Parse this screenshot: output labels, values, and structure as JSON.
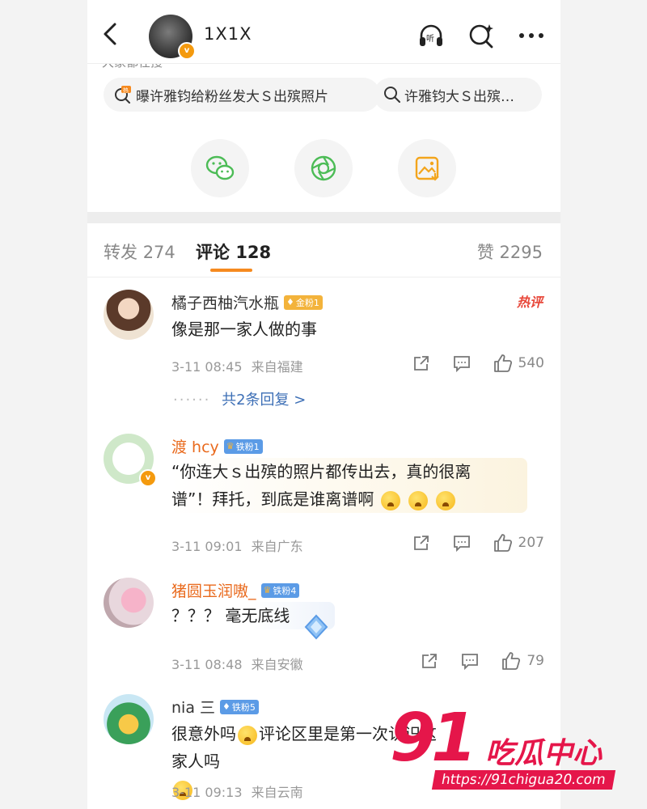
{
  "header": {
    "title": "1X1X",
    "partial_text": "大家都在搜"
  },
  "search_chips": [
    {
      "label": "曝许雅钧给粉丝发大Ｓ出殡照片",
      "hot": true
    },
    {
      "label": "许雅钧大Ｓ出殡…",
      "hot": false
    }
  ],
  "share_buttons": [
    "wechat-icon",
    "moments-icon",
    "save-image-icon"
  ],
  "tabs": {
    "repost_label": "转发",
    "repost_count": "274",
    "comment_label": "评论",
    "comment_count": "128",
    "like_label": "赞",
    "like_count": "2295"
  },
  "comments": [
    {
      "name": "橘子西柚汽水瓶",
      "name_color": "#333333",
      "badge": "金粉1",
      "badge_color": "#f3b33b",
      "text": "像是那一家人做的事",
      "time": "3-11 08:45",
      "location": "来自福建",
      "likes": "540",
      "hot_label": "热评",
      "replies": "共2条回复 >"
    },
    {
      "name": "渡 hcy",
      "name_color": "#e96a1d",
      "badge": "铁粉1",
      "badge_color": "#5b9be6",
      "text_line1": "“你连大ｓ出殡的照片都传出去，真的很离",
      "text_line2": "谱”！拜托，到底是谁离谱啊",
      "time": "3-11 09:01",
      "location": "来自广东",
      "likes": "207"
    },
    {
      "name": "猪圆玉润嗷_",
      "name_color": "#e96a1d",
      "badge": "铁粉4",
      "badge_color": "#5b9be6",
      "text": "？？？ 毫无底线",
      "time": "3-11 08:48",
      "location": "来自安徽",
      "likes": "79"
    },
    {
      "name": "nia 三",
      "name_color": "#333333",
      "badge": "铁粉5",
      "badge_color": "#5b9be6",
      "text_line1": "很意外吗",
      "text_line1b": "评论区里是第一次认识这家人吗",
      "time": "3-11 09:13",
      "location": "来自云南"
    }
  ],
  "watermark": {
    "number": "91",
    "site_name": "吃瓜中心",
    "url": "https://91chigua20.com"
  },
  "colors": {
    "accent": "#f68a1f",
    "link": "#3d6fb6",
    "hot": "#e8473a"
  }
}
